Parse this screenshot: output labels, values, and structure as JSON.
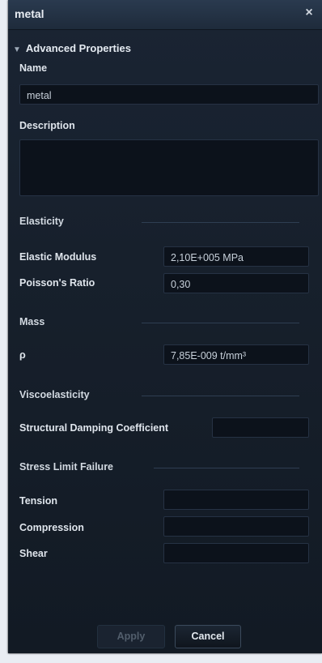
{
  "window": {
    "title": "metal",
    "close_glyph": "×"
  },
  "section": {
    "label": "Advanced Properties",
    "icon": "triangle-down-icon"
  },
  "fields": {
    "name": {
      "label": "Name",
      "value": "metal"
    },
    "description": {
      "label": "Description",
      "value": ""
    }
  },
  "elasticity": {
    "group_label": "Elasticity",
    "elastic_modulus": {
      "label": "Elastic Modulus",
      "value": "2,10E+005 MPa"
    },
    "poisson_ratio": {
      "label": "Poisson's Ratio",
      "value": "0,30"
    }
  },
  "mass": {
    "group_label": "Mass",
    "density": {
      "label": "ρ",
      "value": "7,85E-009 t/mm³"
    }
  },
  "viscoelasticity": {
    "group_label": "Viscoelasticity",
    "damping": {
      "label": "Structural Damping Coefficient",
      "value": ""
    }
  },
  "stress_limit": {
    "group_label": "Stress Limit Failure",
    "tension": {
      "label": "Tension",
      "value": ""
    },
    "compression": {
      "label": "Compression",
      "value": ""
    },
    "shear": {
      "label": "Shear",
      "value": ""
    }
  },
  "buttons": {
    "apply": "Apply",
    "cancel": "Cancel"
  }
}
